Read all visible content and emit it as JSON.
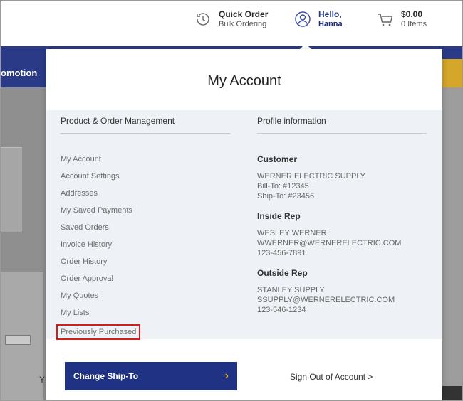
{
  "header": {
    "quick_order": {
      "title": "Quick Order",
      "subtitle": "Bulk Ordering"
    },
    "account": {
      "greeting": "Hello,",
      "name": "Hanna"
    },
    "cart": {
      "amount": "$0.00",
      "items": "0 Items"
    }
  },
  "nav": {
    "promo_label": "omotion"
  },
  "background": {
    "y_text": "Y"
  },
  "panel": {
    "title": "My Account",
    "left_heading": "Product & Order Management",
    "right_heading": "Profile information",
    "links": [
      "My Account",
      "Account Settings",
      "Addresses",
      "My Saved Payments",
      "Saved Orders",
      "Invoice History",
      "Order History",
      "Order Approval",
      "My Quotes",
      "My Lists",
      "Previously Purchased"
    ],
    "customer": {
      "label": "Customer",
      "company": "WERNER ELECTRIC SUPPLY",
      "bill_to": "Bill-To: #12345",
      "ship_to": "Ship-To: #23456"
    },
    "inside_rep": {
      "label": "Inside Rep",
      "name": "WESLEY WERNER",
      "email": "WWERNER@WERNERELECTRIC.COM",
      "phone": "123-456-7891"
    },
    "outside_rep": {
      "label": "Outside Rep",
      "name": "STANLEY SUPPLY",
      "email": "SSUPPLY@WERNERELECTRIC.COM",
      "phone": "123-546-1234"
    },
    "change_ship_to": "Change Ship-To",
    "sign_out": "Sign Out of Account >"
  },
  "colors": {
    "brand_blue": "#1f3284",
    "accent_gold": "#e7b42f",
    "highlight_red": "#d11d1d"
  }
}
